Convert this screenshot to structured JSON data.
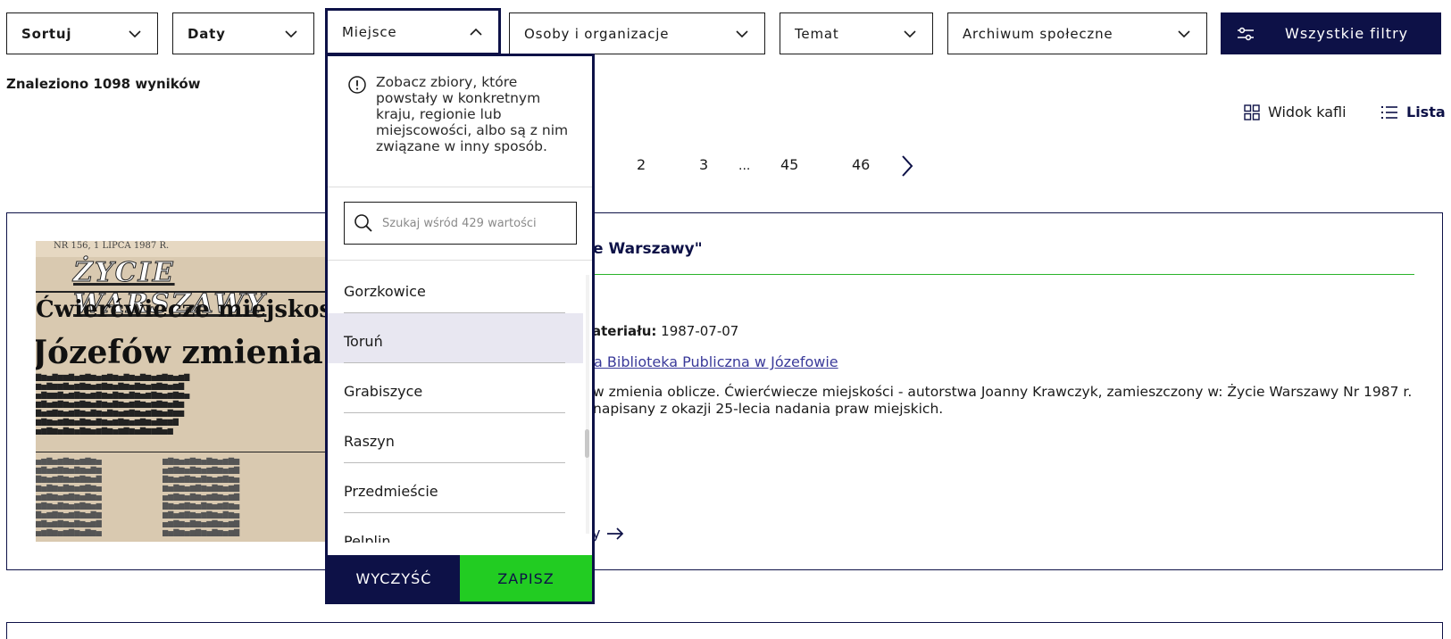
{
  "filters": {
    "sort": "Sortuj",
    "dates": "Daty",
    "place": "Miejsce",
    "people": "Osoby i organizacje",
    "topic": "Temat",
    "archive": "Archiwum społeczne",
    "all_filters": "Wszystkie filtry"
  },
  "results": {
    "count_text": "Znaleziono 1098 wyników"
  },
  "view": {
    "tiles": "Widok kafli",
    "list": "Lista"
  },
  "pagination": {
    "pages": [
      "2",
      "3",
      "45",
      "46"
    ],
    "ellipsis": "..."
  },
  "result_card": {
    "title_fragment": "e Warszawy\"",
    "date_label_fragment": "ateriału",
    "date_value": "1987-07-07",
    "archive_link_fragment": "a Biblioteka Publiczna w Józefowie",
    "description_fragment": "w zmienia oblicze. Ćwierćwiecze miejskości - autorstwa Joanny Krawczyk, zamieszczony w: Życie Warszawy Nr 1987 r. napisany z okazji 25-lecia nadania praw miejskich.",
    "more_fragment": "y",
    "thumbnail": {
      "header": "NR 156, 1 LIPCA 1987 R.",
      "masthead": "ŻYCIE WARSZAWY",
      "headline1": "Ćwierćwiecze miejskoś",
      "headline2": "Józefów zmienia o"
    }
  },
  "place_dropdown": {
    "info": "Zobacz zbiory, które powstały w konkretnym kraju, regionie lub miejscowości, albo są z nim związane w inny sposób.",
    "search_placeholder": "Szukaj wśród 429 wartości",
    "items": [
      "Gorzkowice",
      "Toruń",
      "Grabiszyce",
      "Raszyn",
      "Przedmieście",
      "Pelplin"
    ],
    "highlighted_item": "Toruń",
    "clear": "WYCZYŚĆ",
    "save": "ZAPISZ"
  },
  "colors": {
    "navy": "#0d1147",
    "green": "#22cc22",
    "highlight": "#e8e7f1"
  }
}
